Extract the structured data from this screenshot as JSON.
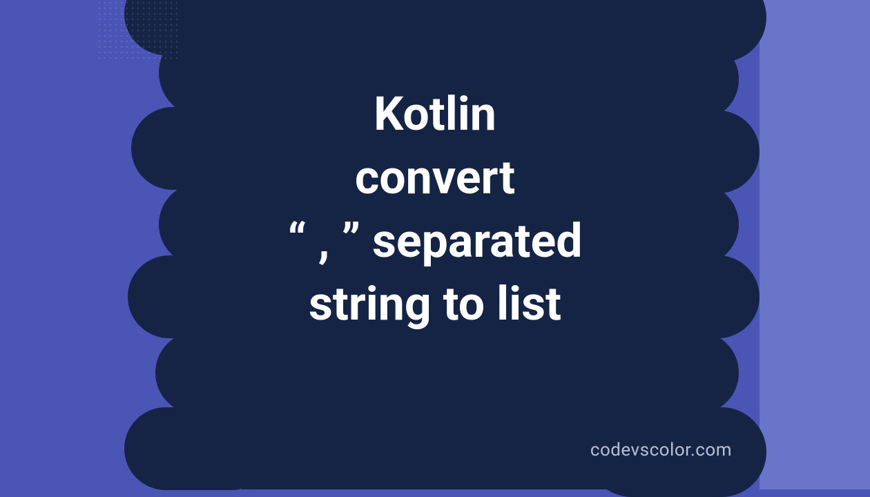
{
  "title": {
    "line1": "Kotlin",
    "line2": "convert",
    "line3": "“ , ” separated",
    "line4": "string to list"
  },
  "watermark": "codevscolor.com",
  "colors": {
    "bg_left": "#4a55b5",
    "bg_right": "#6a75c9",
    "blob": "#152445",
    "text": "#ffffff",
    "watermark": "#b8c0d9"
  }
}
